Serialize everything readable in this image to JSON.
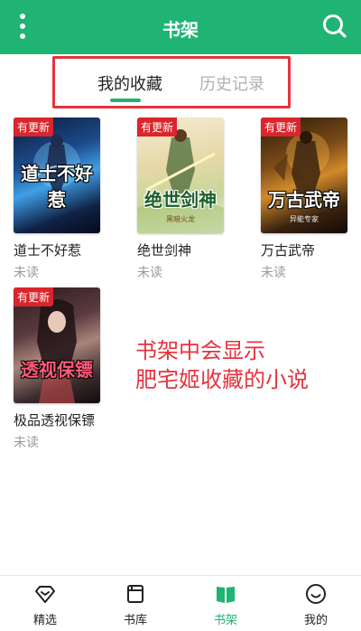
{
  "header": {
    "title": "书架",
    "menu_icon": "more-vertical-icon",
    "search_icon": "search-icon",
    "background": "#1fb374"
  },
  "tabs": [
    {
      "label": "我的收藏",
      "active": true
    },
    {
      "label": "历史记录",
      "active": false
    }
  ],
  "books": [
    {
      "badge": "有更新",
      "cover_title": "道士不好惹",
      "name": "道士不好惹",
      "status": "未读"
    },
    {
      "badge": "有更新",
      "cover_title": "绝世剑神",
      "cover_author": "黑暗火龙",
      "name": "绝世剑神",
      "status": "未读"
    },
    {
      "badge": "有更新",
      "cover_title": "万古武帝",
      "cover_author": "异能专家",
      "name": "万古武帝",
      "status": "未读"
    },
    {
      "badge": "有更新",
      "cover_title": "透视保镖",
      "name": "极品透视保镖",
      "status": "未读"
    }
  ],
  "annotation": {
    "line1": "书架中会显示",
    "line2": "肥宅姬收藏的小说",
    "color": "#e5333f"
  },
  "bottom_nav": [
    {
      "label": "精选",
      "icon": "diamond-icon",
      "active": false
    },
    {
      "label": "书库",
      "icon": "book-library-icon",
      "active": false
    },
    {
      "label": "书架",
      "icon": "open-book-icon",
      "active": true
    },
    {
      "label": "我的",
      "icon": "smiley-face-icon",
      "active": false
    }
  ],
  "colors": {
    "accent": "#1fb374",
    "badge": "#d9252b",
    "highlight_border": "#e5333f"
  }
}
